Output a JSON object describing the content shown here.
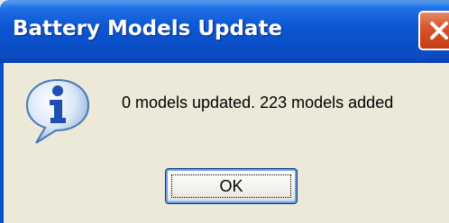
{
  "dialog": {
    "title": "Battery Models Update",
    "message": "0 models updated. 223 models added",
    "ok_label": "OK",
    "icon": "information-icon",
    "close_icon": "close-icon"
  },
  "colors": {
    "titlebar": "#0a4fc8",
    "dialog_background": "#ece9d8",
    "close_button": "#d8542c"
  }
}
